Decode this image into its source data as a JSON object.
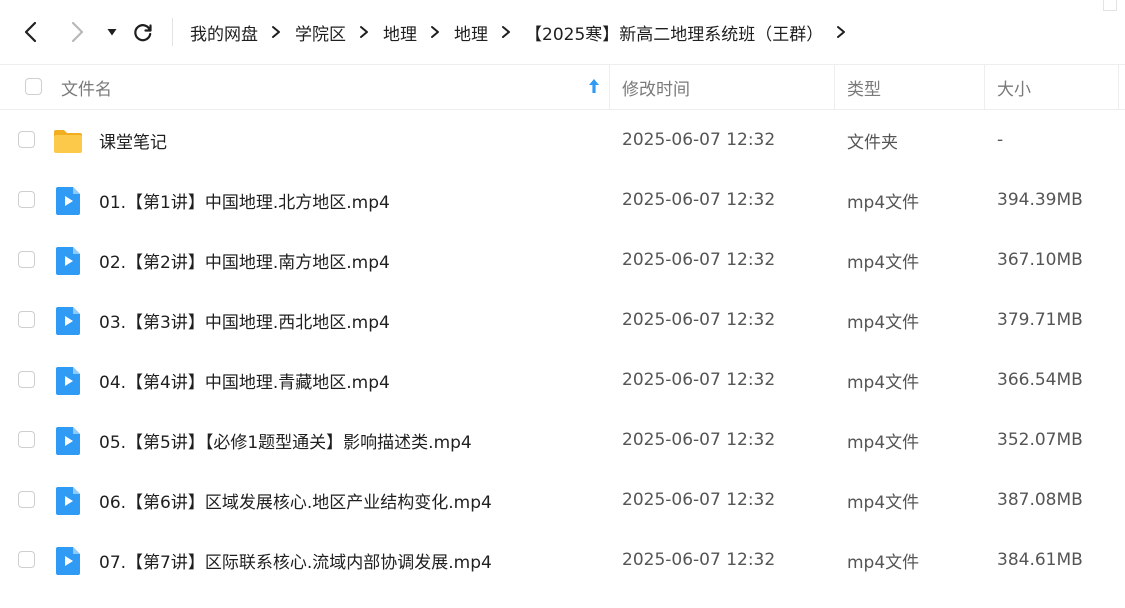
{
  "breadcrumb": [
    "我的网盘",
    "学院区",
    "地理",
    "地理",
    "【2025寒】新高二地理系统班（王群）"
  ],
  "columns": {
    "name": "文件名",
    "modified": "修改时间",
    "type": "类型",
    "size": "大小"
  },
  "rows": [
    {
      "icon": "folder-icon",
      "name": "课堂笔记",
      "modified": "2025-06-07 12:32",
      "type": "文件夹",
      "size": "-"
    },
    {
      "icon": "video-file-icon",
      "name": "01.【第1讲】中国地理.北方地区.mp4",
      "modified": "2025-06-07 12:32",
      "type": "mp4文件",
      "size": "394.39MB"
    },
    {
      "icon": "video-file-icon",
      "name": "02.【第2讲】中国地理.南方地区.mp4",
      "modified": "2025-06-07 12:32",
      "type": "mp4文件",
      "size": "367.10MB"
    },
    {
      "icon": "video-file-icon",
      "name": "03.【第3讲】中国地理.西北地区.mp4",
      "modified": "2025-06-07 12:32",
      "type": "mp4文件",
      "size": "379.71MB"
    },
    {
      "icon": "video-file-icon",
      "name": "04.【第4讲】中国地理.青藏地区.mp4",
      "modified": "2025-06-07 12:32",
      "type": "mp4文件",
      "size": "366.54MB"
    },
    {
      "icon": "video-file-icon",
      "name": "05.【第5讲】【必修1题型通关】影响描述类.mp4",
      "modified": "2025-06-07 12:32",
      "type": "mp4文件",
      "size": "352.07MB"
    },
    {
      "icon": "video-file-icon",
      "name": "06.【第6讲】区域发展核心.地区产业结构变化.mp4",
      "modified": "2025-06-07 12:32",
      "type": "mp4文件",
      "size": "387.08MB"
    },
    {
      "icon": "video-file-icon",
      "name": "07.【第7讲】区际联系核心.流域内部协调发展.mp4",
      "modified": "2025-06-07 12:32",
      "type": "mp4文件",
      "size": "384.61MB"
    }
  ],
  "colors": {
    "folder": "#fcc94a",
    "video": "#2f9bf5",
    "sort_arrow": "#2f9bf5"
  }
}
